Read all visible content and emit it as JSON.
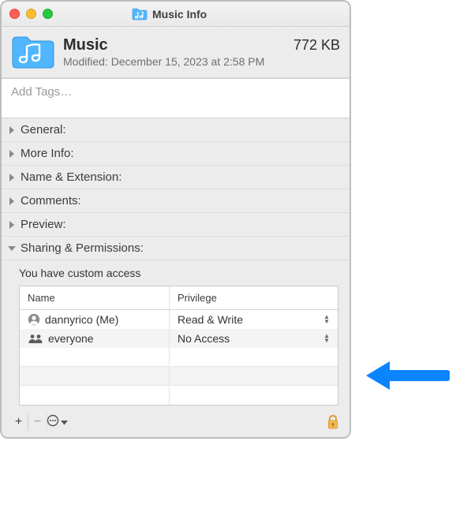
{
  "window": {
    "title": "Music Info"
  },
  "header": {
    "name": "Music",
    "size": "772 KB",
    "modified": "Modified: December 15, 2023 at 2:58 PM"
  },
  "tags": {
    "placeholder": "Add Tags…"
  },
  "sections": {
    "general": "General:",
    "moreInfo": "More Info:",
    "nameExt": "Name & Extension:",
    "comments": "Comments:",
    "preview": "Preview:",
    "sharing": "Sharing & Permissions:"
  },
  "permissions": {
    "hint": "You have custom access",
    "columns": {
      "name": "Name",
      "privilege": "Privilege"
    },
    "rows": [
      {
        "name": "dannyrico (Me)",
        "privilege": "Read & Write",
        "iconType": "single"
      },
      {
        "name": "everyone",
        "privilege": "No Access",
        "iconType": "group"
      }
    ]
  },
  "bottomBar": {
    "add": "+",
    "remove": "−"
  }
}
